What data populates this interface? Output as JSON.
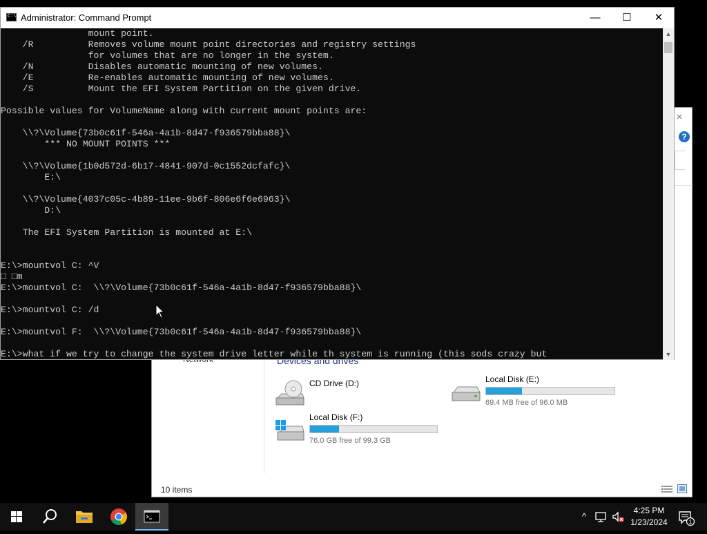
{
  "explorer": {
    "nav_item": "Network",
    "group_title": "Devices and drives",
    "status_count": "10 items",
    "help_glyph": "?",
    "close_glyph": "×",
    "drives": [
      {
        "name": "CD Drive (D:)",
        "free": "",
        "fill": null,
        "icon": "cd-drive-icon"
      },
      {
        "name": "Local Disk (E:)",
        "free": "69.4 MB free of 96.0 MB",
        "fill": 0.28,
        "icon": "hard-drive-icon"
      },
      {
        "name": "Local Disk (F:)",
        "free": "76.0 GB free of 99.3 GB",
        "fill": 0.23,
        "icon": "windows-drive-icon"
      }
    ]
  },
  "cmd": {
    "title": "Administrator: Command Prompt",
    "app_icon_text": "C:\\.",
    "buttons": {
      "minimize": "—",
      "maximize": "☐",
      "close": "✕"
    },
    "lines": [
      "                mount point.",
      "    /R          Removes volume mount point directories and registry settings",
      "                for volumes that are no longer in the system.",
      "    /N          Disables automatic mounting of new volumes.",
      "    /E          Re-enables automatic mounting of new volumes.",
      "    /S          Mount the EFI System Partition on the given drive.",
      "",
      "Possible values for VolumeName along with current mount points are:",
      "",
      "    \\\\?\\Volume{73b0c61f-546a-4a1b-8d47-f936579bba88}\\",
      "        *** NO MOUNT POINTS ***",
      "",
      "    \\\\?\\Volume{1b0d572d-6b17-4841-907d-0c1552dcfafc}\\",
      "        E:\\",
      "",
      "    \\\\?\\Volume{4037c05c-4b89-11ee-9b6f-806e6f6e6963}\\",
      "        D:\\",
      "",
      "    The EFI System Partition is mounted at E:\\",
      "",
      "",
      "E:\\>mountvol C: ^V",
      "□ □m",
      "E:\\>mountvol C:  \\\\?\\Volume{73b0c61f-546a-4a1b-8d47-f936579bba88}\\",
      "",
      "E:\\>mountvol C: /d",
      "",
      "E:\\>mountvol F:  \\\\?\\Volume{73b0c61f-546a-4a1b-8d47-f936579bba88}\\",
      "",
      "E:\\>what if we try to change the system drive letter while th system is running (this sods crazy but"
    ],
    "scroll_up": "▲",
    "scroll_down": "▼"
  },
  "taskbar": {
    "items": [
      "start-icon",
      "search-icon",
      "file-explorer-icon",
      "chrome-icon",
      "command-prompt-icon"
    ],
    "tray": {
      "chevron": "^"
    },
    "time": "4:25 PM",
    "date": "1/23/2024",
    "notification_count": "1"
  },
  "colors": {
    "console_bg": "#0c0c0c",
    "console_text": "#cccccc",
    "taskbar_bg": "#101010",
    "drive_bar_fill": "#26a0da",
    "group_title": "#1e3287"
  }
}
